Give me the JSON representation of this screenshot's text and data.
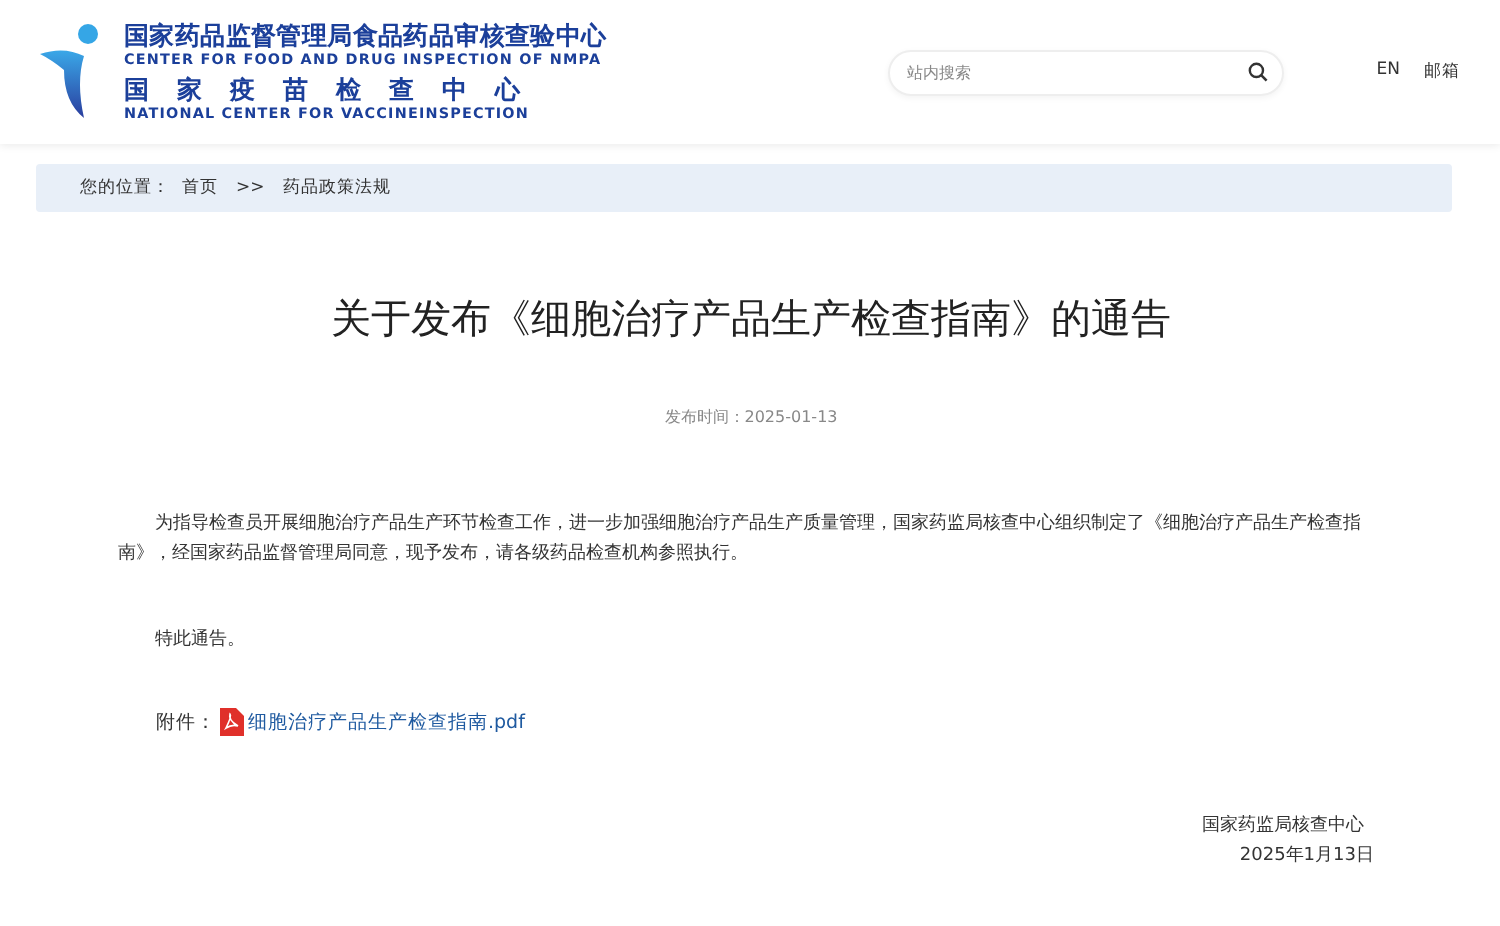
{
  "header": {
    "name_cn": "国家药品监督管理局食品药品审核查验中心",
    "name_en": "CENTER FOR FOOD AND DRUG INSPECTION OF NMPA",
    "sub_cn": "国家疫苗检查中心",
    "sub_en": "NATIONAL CENTER FOR VACCINEINSPECTION",
    "search": {
      "placeholder": "站内搜索"
    },
    "links": [
      {
        "label": "EN"
      },
      {
        "label": "邮箱"
      }
    ]
  },
  "breadcrumb": {
    "label": "您的位置：",
    "items": [
      {
        "label": "首页"
      },
      {
        "label": "药品政策法规"
      }
    ],
    "separator": ">>"
  },
  "article": {
    "title": "关于发布《细胞治疗产品生产检查指南》的通告",
    "date_label": "发布时间：",
    "date": "2025-01-13",
    "paragraphs": [
      "为指导检查员开展细胞治疗产品生产环节检查工作，进一步加强细胞治疗产品生产质量管理，国家药监局核查中心组织制定了《细胞治疗产品生产检查指南》，经国家药品监督管理局同意，现予发布，请各级药品检查机构参照执行。",
      "特此通告。"
    ],
    "attachment": {
      "label": "附件：",
      "file": "细胞治疗产品生产检查指南.pdf"
    },
    "signature": {
      "org": "国家药监局核查中心",
      "date": "2025年1月13日"
    }
  }
}
